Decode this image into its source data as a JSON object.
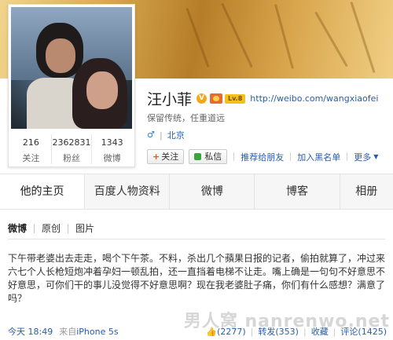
{
  "profile": {
    "name": "汪小菲",
    "v_badge": "V",
    "vip_label": "Lv.8",
    "url": "http://weibo.com/wangxiaofei",
    "motto": "保留传统，任重道远",
    "gender_icon": "male-icon",
    "location": "北京"
  },
  "stats": [
    {
      "num": "216",
      "label": "关注"
    },
    {
      "num": "2362831",
      "label": "粉丝"
    },
    {
      "num": "1343",
      "label": "微博"
    }
  ],
  "actions": {
    "follow": "关注",
    "message": "私信",
    "recommend": "推荐给朋友",
    "blacklist": "加入黑名单",
    "more": "更多"
  },
  "tabs": [
    "他的主页",
    "百度人物资料",
    "微博",
    "博客",
    "相册"
  ],
  "subtabs": [
    "微博",
    "原创",
    "图片"
  ],
  "post": {
    "text": "下午带老婆出去走走，喝个下午茶。不料，杀出几个蘋果日报的记者，偷拍就算了，冲过来六七个人长枪短炮冲着孕妇一顿乱拍，还一直挡着电梯不让走。嘴上确是一句句不好意思不好意思，可你们干的事儿没觉得不好意思啊？现在我老婆肚子痛，你们有什么感想？满意了吗？",
    "time": "今天 18:49",
    "source_prefix": "来自",
    "source": "iPhone 5s",
    "likes": "(2277)",
    "reposts": "转发(353)",
    "favorite": "收藏",
    "comments": "评论(1425)"
  },
  "watermark": "男人窝 nanrenwo.net",
  "colors": {
    "link": "#2a5ca8",
    "banner": "#c48b32",
    "vip": "#f3c21a"
  }
}
